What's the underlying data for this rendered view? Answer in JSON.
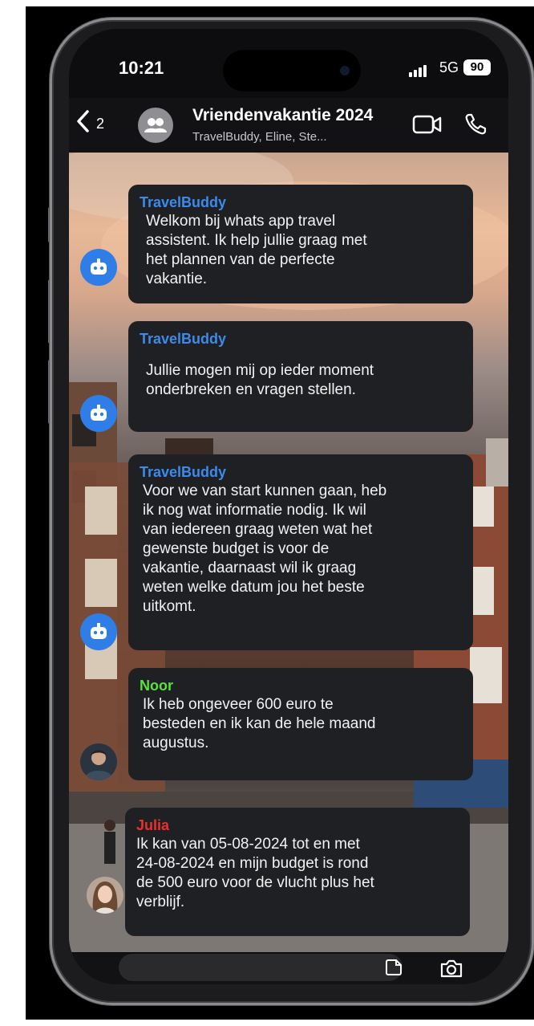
{
  "status": {
    "time": "10:21",
    "network": "5G",
    "battery": "90"
  },
  "header": {
    "back_count": "2",
    "title": "Vriendenvakantie 2024",
    "subtitle": "TravelBuddy, Eline, Ste..."
  },
  "messages": [
    {
      "sender": "TravelBuddy",
      "sender_color": "#3d8ae8",
      "text": "Welkom bij whats app travel\nassistent. Ik help jullie graag met\nhet plannen van de perfecte\nvakantie."
    },
    {
      "sender": "TravelBuddy",
      "sender_color": "#3d8ae8",
      "text": "Jullie mogen mij op ieder moment\nonderbreken en vragen stellen."
    },
    {
      "sender": "TravelBuddy",
      "sender_color": "#3d8ae8",
      "text": "Voor we van start kunnen gaan, heb\nik nog wat informatie nodig. Ik wil\nvan iedereen graag weten wat het\ngewenste budget is voor de\nvakantie, daarnaast wil ik graag\nweten welke datum jou het beste\nuitkomt."
    },
    {
      "sender": "Noor",
      "sender_color": "#5ce03c",
      "text": "Ik heb ongeveer 600 euro te\nbesteden en ik kan de hele maand\naugustus."
    },
    {
      "sender": "Julia",
      "sender_color": "#e8312d",
      "text": "Ik kan van 05-08-2024 tot en met\n24-08-2024 en mijn budget is rond\nde 500 euro voor de vlucht plus het\nverblijf."
    }
  ],
  "icons": {
    "back": "chevron-left-icon",
    "group": "group-avatar-icon",
    "video": "video-call-icon",
    "call": "phone-icon",
    "bot": "robot-icon",
    "sticker": "sticker-icon",
    "camera": "camera-icon"
  },
  "colors": {
    "bubble": "#1f2023",
    "bot_avatar": "#2f7de6",
    "header": "#121214"
  }
}
